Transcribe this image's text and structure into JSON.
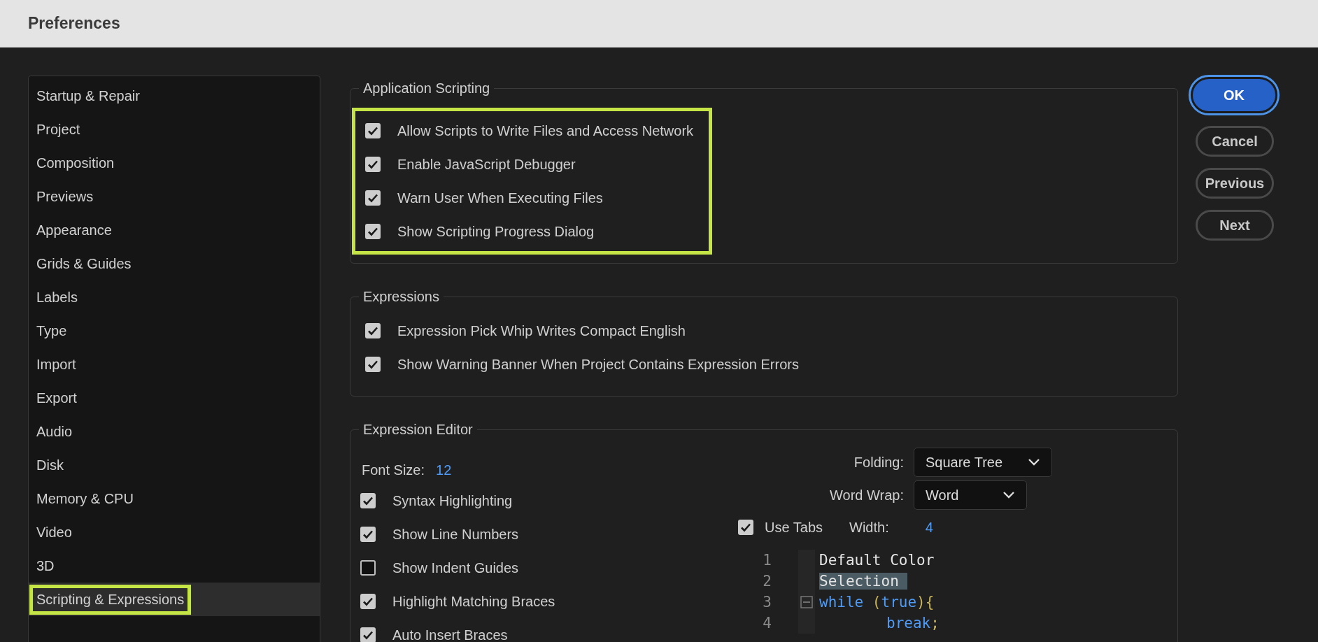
{
  "window": {
    "title": "Preferences"
  },
  "sidebar": {
    "items": [
      {
        "label": "Startup & Repair",
        "selected": false,
        "highlighted": false
      },
      {
        "label": "Project",
        "selected": false,
        "highlighted": false
      },
      {
        "label": "Composition",
        "selected": false,
        "highlighted": false
      },
      {
        "label": "Previews",
        "selected": false,
        "highlighted": false
      },
      {
        "label": "Appearance",
        "selected": false,
        "highlighted": false
      },
      {
        "label": "Grids & Guides",
        "selected": false,
        "highlighted": false
      },
      {
        "label": "Labels",
        "selected": false,
        "highlighted": false
      },
      {
        "label": "Type",
        "selected": false,
        "highlighted": false
      },
      {
        "label": "Import",
        "selected": false,
        "highlighted": false
      },
      {
        "label": "Export",
        "selected": false,
        "highlighted": false
      },
      {
        "label": "Audio",
        "selected": false,
        "highlighted": false
      },
      {
        "label": "Disk",
        "selected": false,
        "highlighted": false
      },
      {
        "label": "Memory & CPU",
        "selected": false,
        "highlighted": false
      },
      {
        "label": "Video",
        "selected": false,
        "highlighted": false
      },
      {
        "label": "3D",
        "selected": false,
        "highlighted": false
      },
      {
        "label": "Scripting & Expressions",
        "selected": true,
        "highlighted": true
      }
    ]
  },
  "sections": [
    {
      "title": "Application Scripting",
      "highlighted": true,
      "options": [
        {
          "label": "Allow Scripts to Write Files and Access Network",
          "checked": true
        },
        {
          "label": "Enable JavaScript Debugger",
          "checked": true
        },
        {
          "label": "Warn User When Executing Files",
          "checked": true
        },
        {
          "label": "Show Scripting Progress Dialog",
          "checked": true
        }
      ]
    },
    {
      "title": "Expressions",
      "highlighted": false,
      "options": [
        {
          "label": "Expression Pick Whip Writes Compact English",
          "checked": true
        },
        {
          "label": "Show Warning Banner When Project Contains Expression Errors",
          "checked": true
        }
      ]
    }
  ],
  "expression_editor": {
    "title": "Expression Editor",
    "font_size": {
      "label": "Font Size:",
      "value": "12"
    },
    "options": [
      {
        "label": "Syntax Highlighting",
        "checked": true
      },
      {
        "label": "Show Line Numbers",
        "checked": true
      },
      {
        "label": "Show Indent Guides",
        "checked": false
      },
      {
        "label": "Highlight Matching Braces",
        "checked": true
      },
      {
        "label": "Auto Insert Braces",
        "checked": true
      }
    ],
    "folding": {
      "label": "Folding:",
      "value": "Square Tree"
    },
    "word_wrap": {
      "label": "Word Wrap:",
      "value": "Word"
    },
    "use_tabs": {
      "label": "Use Tabs",
      "checked": true
    },
    "tab_width": {
      "label": "Width:",
      "value": "4"
    },
    "code_lines": [
      {
        "number": "1",
        "fold": false,
        "indented": false,
        "tokens": [
          {
            "text": "Default Color",
            "kind": "plain"
          }
        ]
      },
      {
        "number": "2",
        "fold": false,
        "indented": false,
        "tokens": [
          {
            "text": "Selection ",
            "kind": "selection"
          }
        ]
      },
      {
        "number": "3",
        "fold": true,
        "indented": false,
        "tokens": [
          {
            "text": "while",
            "kind": "keyword"
          },
          {
            "text": " (",
            "kind": "punct"
          },
          {
            "text": "true",
            "kind": "keyword"
          },
          {
            "text": "){",
            "kind": "punct"
          }
        ]
      },
      {
        "number": "4",
        "fold": false,
        "indented": true,
        "tokens": [
          {
            "text": "break",
            "kind": "keyword"
          },
          {
            "text": ";",
            "kind": "punct"
          }
        ]
      }
    ]
  },
  "buttons": [
    {
      "label": "OK",
      "default": true
    },
    {
      "label": "Cancel",
      "default": false
    },
    {
      "label": "Previous",
      "default": false
    },
    {
      "label": "Next",
      "default": false
    }
  ]
}
